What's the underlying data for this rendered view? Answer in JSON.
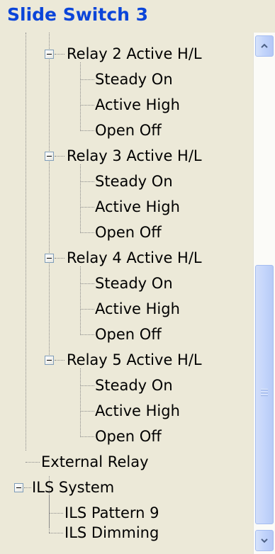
{
  "title": "Slide Switch 3",
  "tree": [
    {
      "label": "Relay 2 Active H/L",
      "level": 1,
      "expanded": true
    },
    {
      "label": "Steady On",
      "level": 2
    },
    {
      "label": "Active High",
      "level": 2
    },
    {
      "label": "Open Off",
      "level": 2
    },
    {
      "label": "Relay 3 Active H/L",
      "level": 1,
      "expanded": true
    },
    {
      "label": "Steady On",
      "level": 2
    },
    {
      "label": "Active High",
      "level": 2
    },
    {
      "label": "Open Off",
      "level": 2
    },
    {
      "label": "Relay 4 Active H/L",
      "level": 1,
      "expanded": true
    },
    {
      "label": "Steady On",
      "level": 2
    },
    {
      "label": "Active High",
      "level": 2
    },
    {
      "label": "Open Off",
      "level": 2
    },
    {
      "label": "Relay 5 Active H/L",
      "level": 1,
      "expanded": true
    },
    {
      "label": "Steady On",
      "level": 2
    },
    {
      "label": "Active High",
      "level": 2
    },
    {
      "label": "Open Off",
      "level": 2
    },
    {
      "label": "External Relay",
      "level": 0
    },
    {
      "label": "ILS System",
      "level": 0,
      "expanded": true
    },
    {
      "label": "ILS Pattern 9",
      "level": 1
    },
    {
      "label": "ILS Dimming",
      "level": 1
    }
  ],
  "scrollbar": {
    "position_fraction": 0.85,
    "up_icon": "chevron-up-icon",
    "down_icon": "chevron-down-icon"
  },
  "colors": {
    "title": "#0b45d9",
    "panel": "#ece9d8",
    "scroll_thumb": "#c4d5fb"
  }
}
